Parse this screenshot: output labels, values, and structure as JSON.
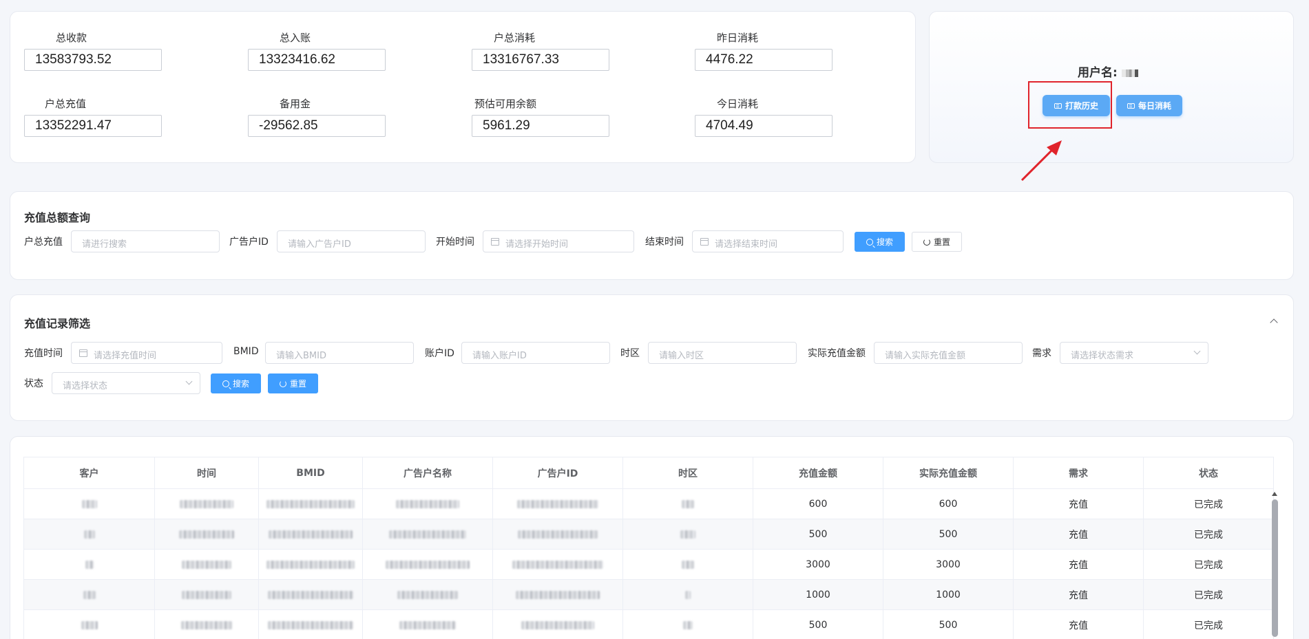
{
  "summary": {
    "total_collection_label": "总收款",
    "total_collection_value": "13583793.52",
    "total_income_label": "总入账",
    "total_income_value": "13323416.62",
    "account_total_consumption_label": "户总消耗",
    "account_total_consumption_value": "13316767.33",
    "yesterday_consumption_label": "昨日消耗",
    "yesterday_consumption_value": "4476.22",
    "account_total_recharge_label": "户总充值",
    "account_total_recharge_value": "13352291.47",
    "reserve_label": "备用金",
    "reserve_value": "-29562.85",
    "estimated_balance_label": "预估可用余额",
    "estimated_balance_value": "5961.29",
    "today_consumption_label": "今日消耗",
    "today_consumption_value": "4704.49"
  },
  "user": {
    "username_label": "用户名:",
    "history_button": "打款历史",
    "daily_button": "每日消耗"
  },
  "query": {
    "title": "充值总额查询",
    "recharge_label": "户总充值",
    "recharge_placeholder": "请进行搜索",
    "ad_id_label": "广告户ID",
    "ad_id_placeholder": "请输入广告户ID",
    "start_label": "开始时间",
    "start_placeholder": "请选择开始时间",
    "end_label": "结束时间",
    "end_placeholder": "请选择结束时间",
    "search_button": "搜索",
    "reset_button": "重置"
  },
  "filter": {
    "title": "充值记录筛选",
    "time_label": "充值时间",
    "time_placeholder": "请选择充值时间",
    "bmid_label": "BMID",
    "bmid_placeholder": "请输入BMID",
    "account_label": "账户ID",
    "account_placeholder": "请输入账户ID",
    "timezone_label": "时区",
    "timezone_placeholder": "请输入时区",
    "actual_label": "实际充值金额",
    "actual_placeholder": "请输入实际充值金额",
    "demand_label": "需求",
    "demand_placeholder": "请选择状态需求",
    "status_label": "状态",
    "status_placeholder": "请选择状态",
    "search_button": "搜索",
    "reset_button": "重置"
  },
  "table": {
    "headers": [
      "客户",
      "时间",
      "BMID",
      "广告户名称",
      "广告户ID",
      "时区",
      "充值金额",
      "实际充值金额",
      "需求",
      "状态"
    ],
    "rows": [
      {
        "amount": "600",
        "actual": "600",
        "demand": "充值",
        "status": "已完成"
      },
      {
        "amount": "500",
        "actual": "500",
        "demand": "充值",
        "status": "已完成"
      },
      {
        "amount": "3000",
        "actual": "3000",
        "demand": "充值",
        "status": "已完成"
      },
      {
        "amount": "1000",
        "actual": "1000",
        "demand": "充值",
        "status": "已完成"
      },
      {
        "amount": "500",
        "actual": "500",
        "demand": "充值",
        "status": "已完成"
      }
    ]
  },
  "colors": {
    "primary": "#409eff",
    "highlight": "#e0232b"
  }
}
